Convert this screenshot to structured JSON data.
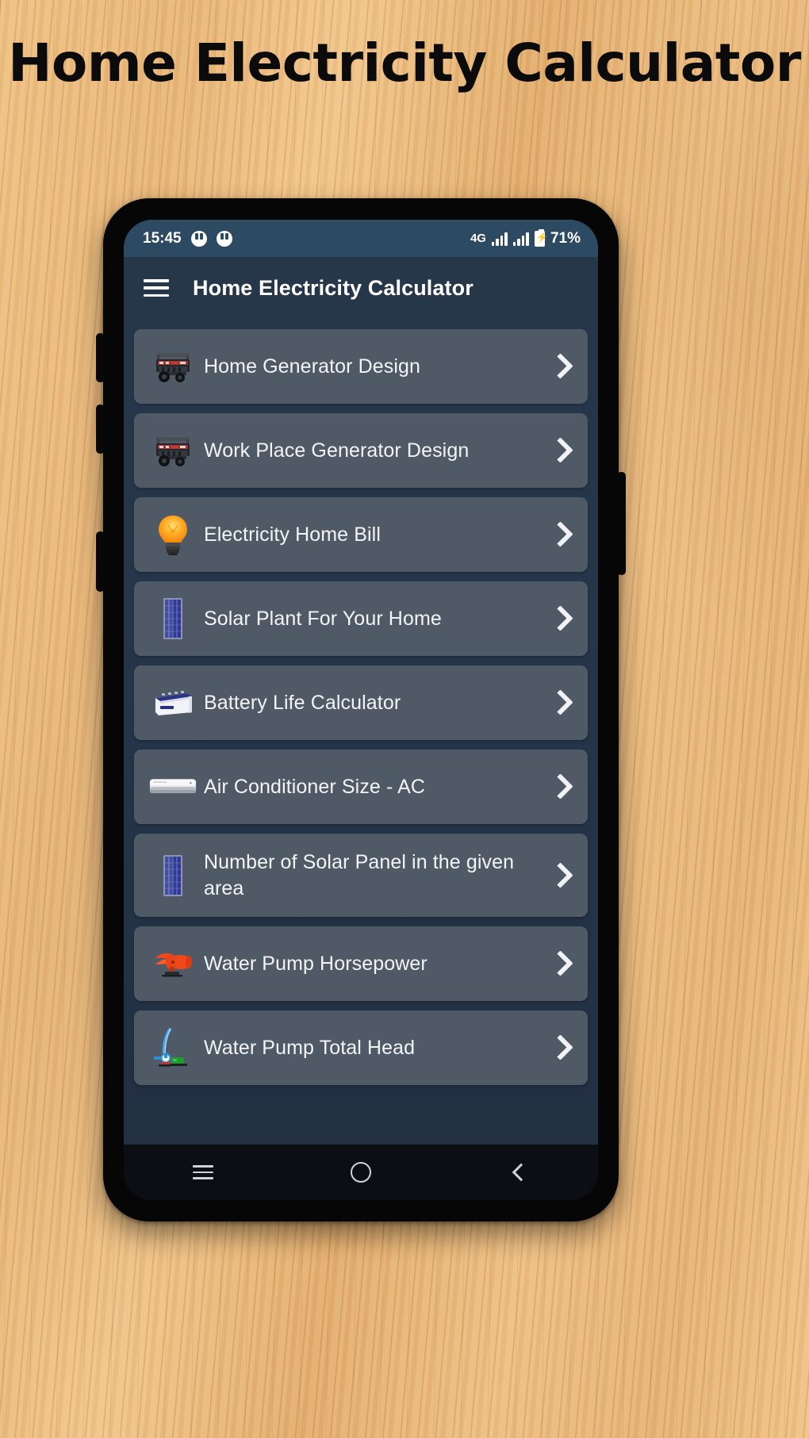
{
  "page": {
    "title": "Home Electricity Calculator"
  },
  "status_bar": {
    "time": "15:45",
    "network": "4G",
    "battery_percent": "71%",
    "notification_icons": [
      "notification-dot-icon",
      "notification-dot-icon"
    ],
    "signal_icons": [
      "signal-bars-icon",
      "signal-bars-icon"
    ],
    "battery_icon": "battery-charging-icon"
  },
  "app_bar": {
    "menu_icon": "hamburger-menu-icon",
    "title": "Home Electricity Calculator"
  },
  "list": {
    "items": [
      {
        "label": "Home Generator Design",
        "icon": "generator-icon",
        "chevron": "chevron-right-icon"
      },
      {
        "label": "Work Place Generator Design",
        "icon": "generator-icon",
        "chevron": "chevron-right-icon"
      },
      {
        "label": "Electricity Home Bill",
        "icon": "light-bulb-icon",
        "chevron": "chevron-right-icon"
      },
      {
        "label": "Solar Plant For Your Home",
        "icon": "solar-panel-icon",
        "chevron": "chevron-right-icon"
      },
      {
        "label": "Battery Life Calculator",
        "icon": "battery-box-icon",
        "chevron": "chevron-right-icon"
      },
      {
        "label": "Air Conditioner Size - AC",
        "icon": "air-conditioner-icon",
        "chevron": "chevron-right-icon"
      },
      {
        "label": "Number of Solar Panel in the given area",
        "icon": "solar-panel-icon",
        "chevron": "chevron-right-icon"
      },
      {
        "label": "Water Pump Horsepower",
        "icon": "water-pump-icon",
        "chevron": "chevron-right-icon"
      },
      {
        "label": "Water Pump Total Head",
        "icon": "water-pipe-icon",
        "chevron": "chevron-right-icon"
      }
    ]
  },
  "nav_bar": {
    "recent_label": "recent-apps-icon",
    "home_label": "home-circle-icon",
    "back_label": "back-arrow-icon"
  },
  "colors": {
    "status_bar": "#2d4a63",
    "app_bar": "#27374a",
    "card": "#505a66",
    "body": "#253449",
    "text": "#f2f4f6",
    "bulb": "#ff9a16",
    "solar": "#2a3a8c",
    "pump": "#f1481a",
    "title": "#0b0b0b"
  }
}
